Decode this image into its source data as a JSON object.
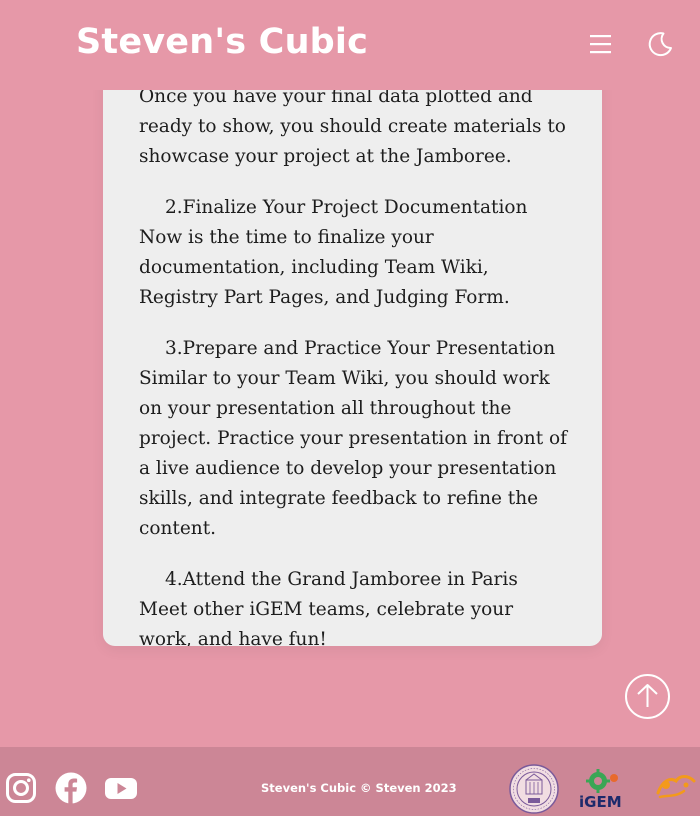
{
  "header": {
    "title": "Steven's Cubic"
  },
  "content": {
    "paragraphs": [
      {
        "heading": "",
        "body": "Once you have your final data plotted and ready to show, you should create materials to showcase your project at the Jamboree."
      },
      {
        "heading": "2.Finalize Your Project Documentation",
        "body": "Now is the time to finalize your documentation, including Team Wiki, Registry Part Pages, and Judging Form."
      },
      {
        "heading": "3.Prepare and Practice Your Presentation",
        "body": "Similar to your Team Wiki, you should work on your presentation all throughout the project. Practice your presentation in front of a live audience to develop your presentation skills, and integrate feedback to refine the content."
      },
      {
        "heading": "4.Attend the Grand Jamboree in Paris",
        "body": "Meet other iGEM teams, celebrate your work, and have fun!"
      }
    ]
  },
  "footer": {
    "copyright": "Steven's Cubic © Steven 2023",
    "logos": {
      "igem_text": "iGEM"
    }
  },
  "icons": {
    "menu": "hamburger-menu-icon",
    "theme": "moon-icon",
    "back_to_top": "arrow-up-icon",
    "instagram": "instagram-icon",
    "facebook": "facebook-icon",
    "youtube": "youtube-icon"
  },
  "colors": {
    "background": "#e698a8",
    "card": "#eeeeee",
    "footer": "#cc8696",
    "text": "#1d1d1d",
    "header_text": "#ffffff"
  }
}
